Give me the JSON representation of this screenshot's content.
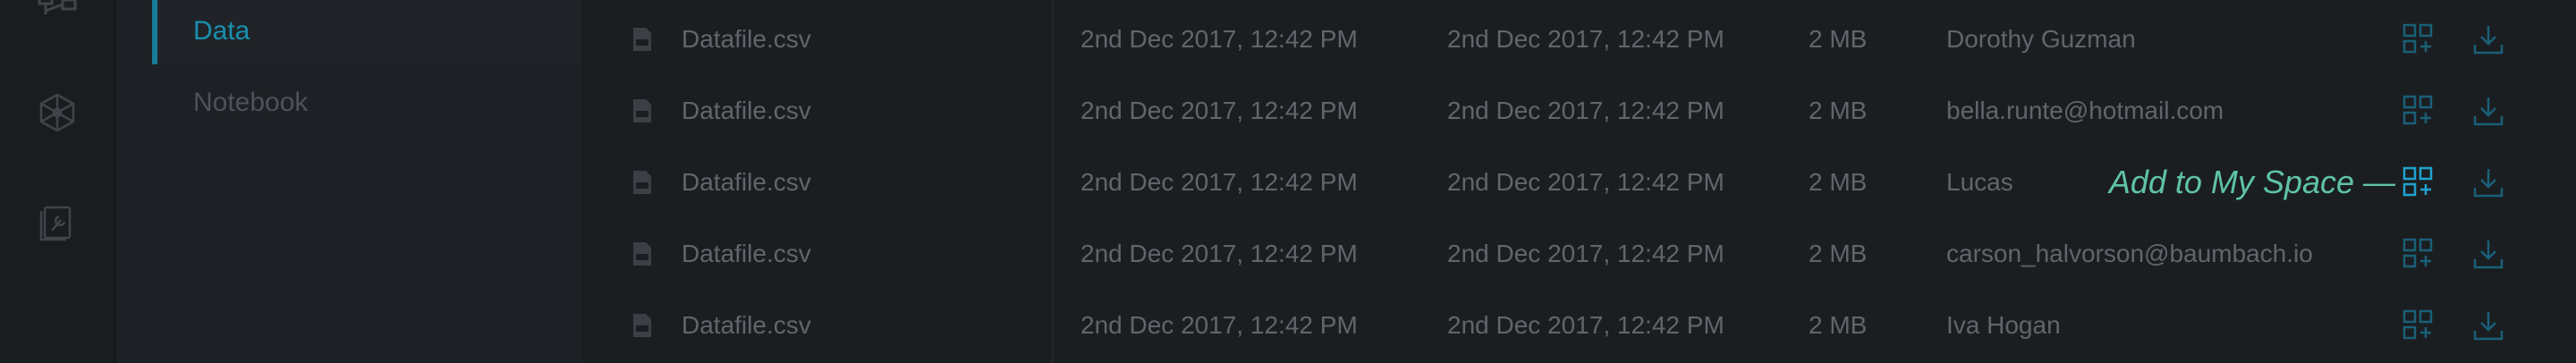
{
  "sidebar": {
    "icons": [
      "hierarchy-icon",
      "network-icon",
      "tools-icon"
    ]
  },
  "subnav": {
    "items": [
      {
        "label": "Data",
        "active": true
      },
      {
        "label": "Notebook",
        "active": false
      }
    ]
  },
  "files": {
    "rows": [
      {
        "name": "Datafile.csv",
        "created": "2nd Dec 2017, 12:42 PM",
        "modified": "2nd Dec 2017, 12:42 PM",
        "size": "2 MB",
        "owner": "Dorothy Guzman"
      },
      {
        "name": "Datafile.csv",
        "created": "2nd Dec 2017, 12:42 PM",
        "modified": "2nd Dec 2017, 12:42 PM",
        "size": "2 MB",
        "owner": "bella.runte@hotmail.com"
      },
      {
        "name": "Datafile.csv",
        "created": "2nd Dec 2017, 12:42 PM",
        "modified": "2nd Dec 2017, 12:42 PM",
        "size": "2 MB",
        "owner": "Lucas"
      },
      {
        "name": "Datafile.csv",
        "created": "2nd Dec 2017, 12:42 PM",
        "modified": "2nd Dec 2017, 12:42 PM",
        "size": "2 MB",
        "owner": "carson_halvorson@baumbach.io"
      },
      {
        "name": "Datafile.csv",
        "created": "2nd Dec 2017, 12:42 PM",
        "modified": "2nd Dec 2017, 12:42 PM",
        "size": "2 MB",
        "owner": "Iva Hogan"
      }
    ],
    "file_icon": "csv-file-icon",
    "action_icons": [
      "add-to-space-icon",
      "download-icon"
    ]
  },
  "tooltip": {
    "text": "Add to My Space —"
  },
  "colors": {
    "background": "#1b1e21",
    "accent": "#1a8fb0",
    "tooltip": "#5fc3a8",
    "text_muted": "#5f666c",
    "icon_active": "#1ea3d0",
    "icon_dim": "#1a6078"
  }
}
